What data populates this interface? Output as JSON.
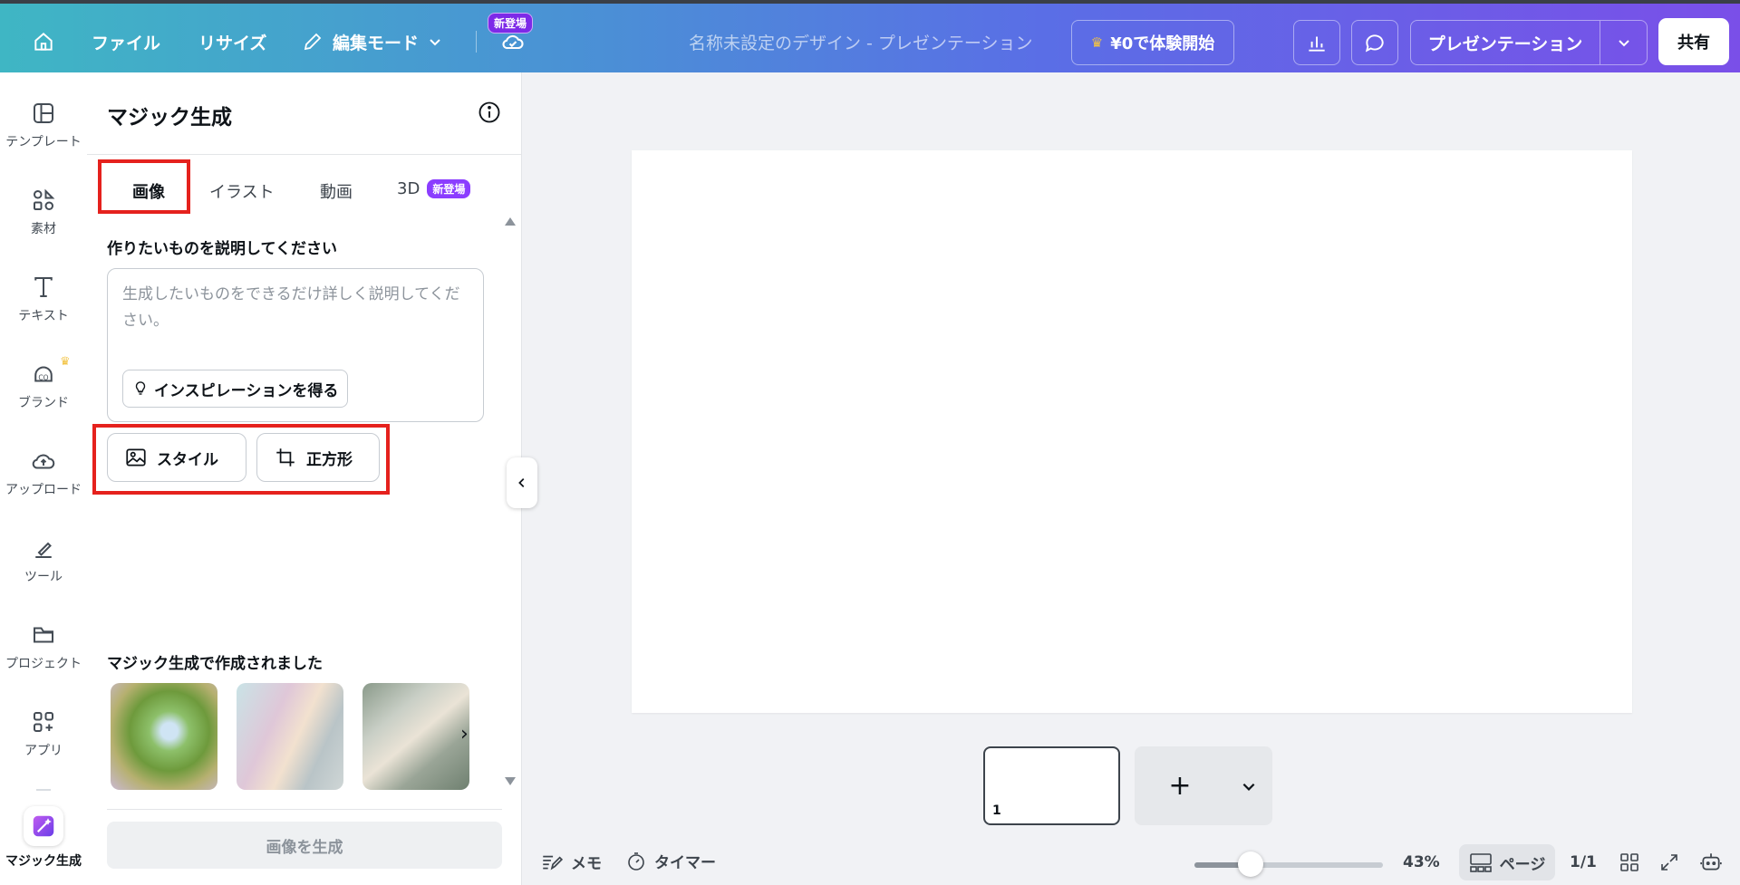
{
  "topbar": {
    "file": "ファイル",
    "resize": "リサイズ",
    "edit_mode": "編集モード",
    "new_badge": "新登場",
    "doc_title": "名称未設定のデザイン - プレゼンテーション",
    "trial": "¥0で体験開始",
    "present": "プレゼンテーション",
    "share": "共有"
  },
  "rail": {
    "items": [
      {
        "label": "テンプレート",
        "icon": "template-icon"
      },
      {
        "label": "素材",
        "icon": "elements-icon"
      },
      {
        "label": "テキスト",
        "icon": "text-icon"
      },
      {
        "label": "ブランド",
        "icon": "brand-icon"
      },
      {
        "label": "アップロード",
        "icon": "upload-icon"
      },
      {
        "label": "ツール",
        "icon": "tools-icon"
      },
      {
        "label": "プロジェクト",
        "icon": "folder-icon"
      },
      {
        "label": "アプリ",
        "icon": "apps-icon"
      }
    ],
    "magic": "マジック生成"
  },
  "panel": {
    "title": "マジック生成",
    "tabs": [
      "画像",
      "イラスト",
      "動画",
      "3D"
    ],
    "tab_badge": "新登場",
    "prompt_label": "作りたいものを説明してください",
    "prompt_placeholder": "生成したいものをできるだけ詳しく説明してください。",
    "inspiration": "インスピレーションを得る",
    "style_button": "スタイル",
    "aspect_button": "正方形",
    "gallery_title": "マジック生成で作成されました",
    "generate": "画像を生成"
  },
  "canvas": {
    "page_number": "1"
  },
  "bottombar": {
    "memo": "メモ",
    "timer": "タイマー",
    "zoom": "43%",
    "zoom_level": 0.3,
    "pages": "ページ",
    "page_count": "1/1"
  },
  "colors": {
    "highlight": "#e5211d",
    "brand_purple": "#8b3dff",
    "crown": "#f3c343"
  }
}
